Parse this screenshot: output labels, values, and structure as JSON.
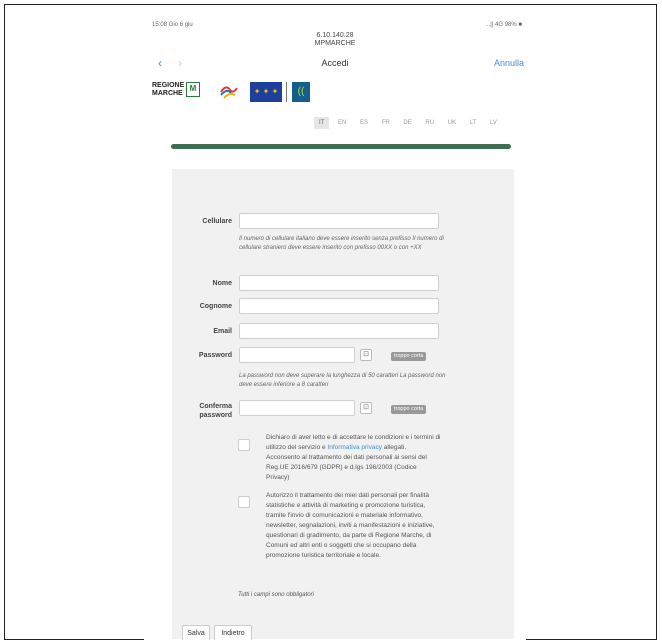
{
  "status": {
    "time": "15:08",
    "date": "Gio 6 giu",
    "battery": "..|| 4G 98% ■"
  },
  "url": {
    "ip": "6.10.140.28",
    "host": "MPMARCHE"
  },
  "nav": {
    "back": "‹",
    "forward": "›",
    "title": "Accedi",
    "cancel": "Annulla"
  },
  "logos": {
    "regione_line1": "REGIONE",
    "regione_line2": "MARCHE",
    "eu_stars": "✦ ✦ ✦",
    "wifi": "(("
  },
  "langs": [
    "IT",
    "EN",
    "ES",
    "FR",
    "DE",
    "RU",
    "UK",
    "LT",
    "LV"
  ],
  "form": {
    "cellulare_label": "Cellulare",
    "cellulare_hint": "Il numero di cellulare italiano deve essere inserito senza prefisso Il numero di cellulare straniero deve essere inserito con prefisso 00XX o con +XX",
    "nome_label": "Nome",
    "cognome_label": "Cognome",
    "email_label": "Email",
    "password_label": "Password",
    "password_badge": "troppo corta",
    "password_hint": "La password non deve superare la lunghezza di 50 caratteri La password non deve essere inferiore a 8 caratteri",
    "conferma_label": "Conferma password",
    "conferma_badge": "troppo corta",
    "eye": "⊡",
    "consent1_pre": "Dichiaro di aver letto e di accettare le condizioni e i termini di utilizzo del servizio e ",
    "consent1_link": "Informativa privacy",
    "consent1_post": " allegati. Acconsento al trattamento dei dati personali ai sensi del Reg.UE 2016/679 (GDPR) e d.lgs 196/2003 (Codice Privacy)",
    "consent2": "Autorizzo il trattamento dei miei dati personali per finalità statistiche e attività di marketing e promozione turistica, tramite l'invio di comunicazioni e materiale informativo, newsletter, segnalazioni, inviti a manifestazioni e iniziative, questionari di gradimento, da parte di Regione Marche, di Comuni ed altri enti o soggetti che si occupano della promozione turistica territoriale e locale.",
    "required_note": "Tutti i campi sono obbligatori",
    "save_label": "Salva",
    "back_label": "Indietro"
  }
}
